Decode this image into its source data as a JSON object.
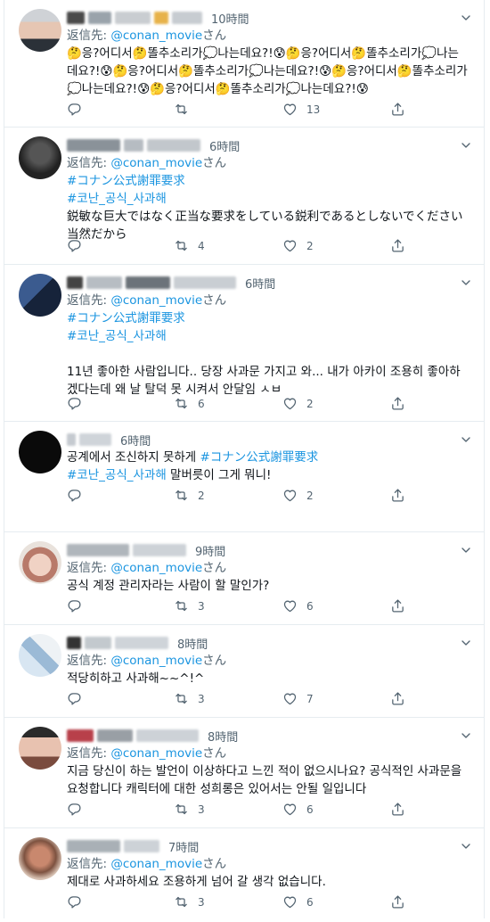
{
  "colors": {
    "accent": "#1b95e0",
    "muted": "#536471",
    "border": "#e6ecf0"
  },
  "icons": [
    "reply-icon",
    "retweet-icon",
    "like-icon",
    "share-icon",
    "chevron-down-icon"
  ],
  "tweets": [
    {
      "time": "10時間",
      "reply_prefix": "返信先:",
      "reply_handle": "@conan_movie",
      "reply_suffix": "さん",
      "text": "🤔응?어디서🤔똘추소리가💭나는데요?!😰🤔응?어디서🤔똘추소리가💭나는데요?!😰🤔응?어디서🤔똘추소리가💭나는데요?!😰🤔응?어디서🤔똘추소리가💭나는데요?!😰🤔응?어디서🤔똘추소리가💭나는데요?!😰",
      "counts": {
        "reply": "",
        "retweet": "",
        "like": "13"
      }
    },
    {
      "time": "6時間",
      "reply_prefix": "返信先:",
      "reply_handle": "@conan_movie",
      "reply_suffix": "さん",
      "tags": [
        "#コナン公式謝罪要求",
        "#코난_공식_사과해"
      ],
      "text": "鋭敏な巨大ではなく正当な要求をしている鋭利であるとしないでください当然だから",
      "counts": {
        "reply": "",
        "retweet": "4",
        "like": "2"
      }
    },
    {
      "time": "6時間",
      "reply_prefix": "返信先:",
      "reply_handle": "@conan_movie",
      "reply_suffix": "さん",
      "tags": [
        "#コナン公式謝罪要求",
        "#코난_공식_사과해"
      ],
      "text": "11년 좋아한 사람입니다.. 당장 사과문 가지고 와... 내가 아카이 조용히 좋아하겠다는데 왜 날 탈덕 못 시켜서 안달임 ㅅㅂ",
      "counts": {
        "reply": "",
        "retweet": "6",
        "like": "2"
      }
    },
    {
      "time": "6時間",
      "text_part1": "공계에서 조신하지 못하게 ",
      "tag1": "#コナン公式謝罪要求",
      "tag2": "#코난_공식_사과해",
      "text_part2": " 말버릇이 그게 뭐니!",
      "counts": {
        "reply": "",
        "retweet": "2",
        "like": "2"
      }
    },
    {
      "time": "9時間",
      "reply_prefix": "返信先:",
      "reply_handle": "@conan_movie",
      "reply_suffix": "さん",
      "text": "공식 계정 관리자라는 사람이 할 말인가?",
      "counts": {
        "reply": "",
        "retweet": "3",
        "like": "6"
      }
    },
    {
      "time": "8時間",
      "reply_prefix": "返信先:",
      "reply_handle": "@conan_movie",
      "reply_suffix": "さん",
      "text": "적당히하고 사과해~~^!^",
      "counts": {
        "reply": "",
        "retweet": "3",
        "like": "7"
      }
    },
    {
      "time": "8時間",
      "reply_prefix": "返信先:",
      "reply_handle": "@conan_movie",
      "reply_suffix": "さん",
      "text": "지금 당신이 하는 발언이 이상하다고 느낀 적이 없으시나요? 공식적인 사과문을 요청합니다 캐릭터에 대한 성희롱은 있어서는 안될 일입니다",
      "counts": {
        "reply": "",
        "retweet": "3",
        "like": "6"
      }
    },
    {
      "time": "7時間",
      "reply_prefix": "返信先:",
      "reply_handle": "@conan_movie",
      "reply_suffix": "さん",
      "text": "제대로 사과하세요 조용하게 넘어 갈 생각 없습니다.",
      "counts": {
        "reply": "",
        "retweet": "3",
        "like": "6"
      }
    }
  ]
}
